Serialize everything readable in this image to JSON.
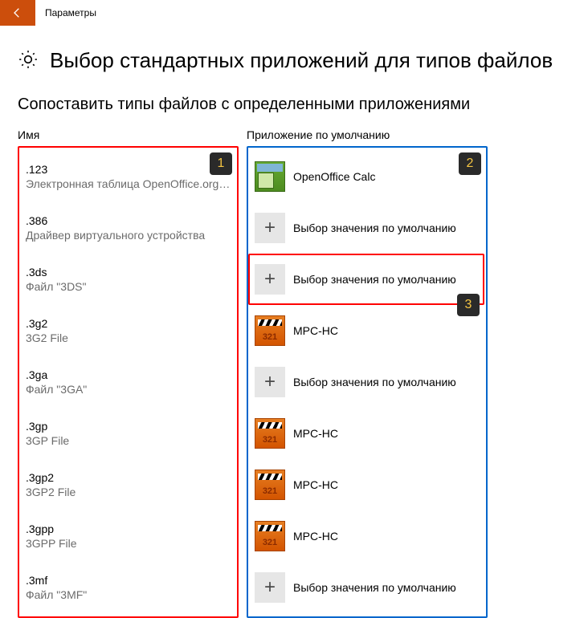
{
  "titlebar": {
    "back_icon": "arrow-left",
    "title": "Параметры"
  },
  "page": {
    "h1": "Выбор стандартных приложений для типов файлов",
    "h2": "Сопоставить типы файлов с определенными приложениями"
  },
  "columns": {
    "left_header": "Имя",
    "right_header": "Приложение по умолчанию"
  },
  "rows": [
    {
      "ext": ".123",
      "desc": "Электронная таблица OpenOffice.org…",
      "app": "OpenOffice Calc",
      "icon": "calc"
    },
    {
      "ext": ".386",
      "desc": "Драйвер виртуального устройства",
      "app": "Выбор значения по умолчанию",
      "icon": "plus"
    },
    {
      "ext": ".3ds",
      "desc": "Файл \"3DS\"",
      "app": "Выбор значения по умолчанию",
      "icon": "plus",
      "highlight": true
    },
    {
      "ext": ".3g2",
      "desc": "3G2 File",
      "app": "MPC-HC",
      "icon": "mpc"
    },
    {
      "ext": ".3ga",
      "desc": "Файл \"3GA\"",
      "app": "Выбор значения по умолчанию",
      "icon": "plus"
    },
    {
      "ext": ".3gp",
      "desc": "3GP File",
      "app": "MPC-HC",
      "icon": "mpc"
    },
    {
      "ext": ".3gp2",
      "desc": "3GP2 File",
      "app": "MPC-HC",
      "icon": "mpc"
    },
    {
      "ext": ".3gpp",
      "desc": "3GPP File",
      "app": "MPC-HC",
      "icon": "mpc"
    },
    {
      "ext": ".3mf",
      "desc": "Файл \"3MF\"",
      "app": "Выбор значения по умолчанию",
      "icon": "plus"
    }
  ],
  "annotations": {
    "b1": "1",
    "b2": "2",
    "b3": "3"
  },
  "mpc_num": "321"
}
